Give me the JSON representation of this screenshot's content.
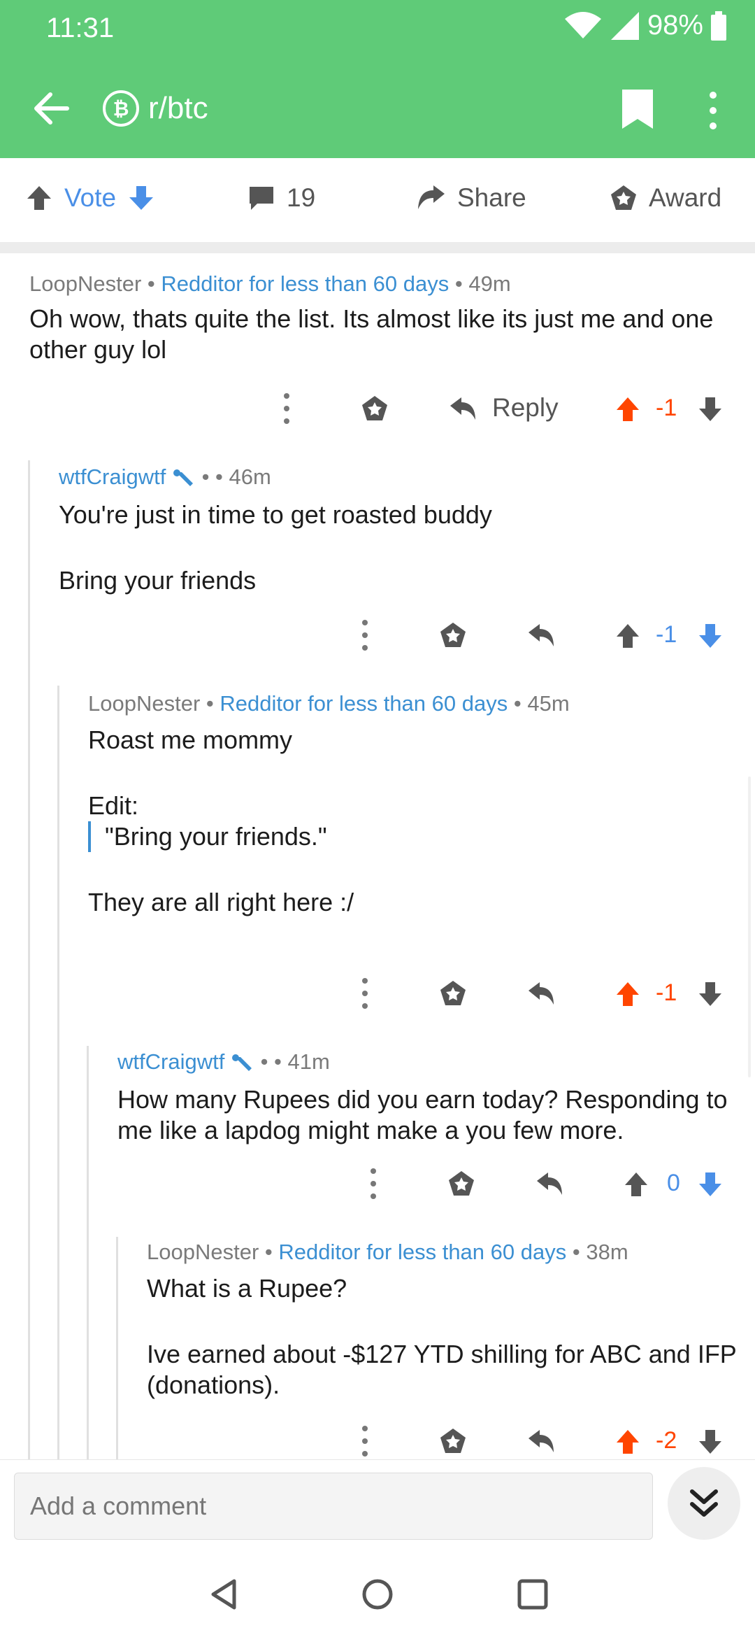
{
  "status": {
    "time": "11:31",
    "battery": "98%"
  },
  "header": {
    "subreddit": "r/btc"
  },
  "post_actions": {
    "vote_label": "Vote",
    "comment_count": "19",
    "share_label": "Share",
    "award_label": "Award"
  },
  "comments": [
    {
      "author": "LoopNester",
      "sep": "•",
      "flair": "Redditor for less than 60 days",
      "sep2": "•",
      "age": "49m",
      "body": [
        "Oh wow, thats quite the list. Its almost like its just me and one other guy lol"
      ],
      "reply_label": "Reply",
      "score": "-1",
      "vote_state": "up"
    },
    {
      "author": "wtfCraigwtf",
      "sep": "•",
      "sep2": "•",
      "age": "46m",
      "body": [
        "You're just in time to get roasted buddy",
        "Bring your friends"
      ],
      "score": "-1",
      "vote_state": "down"
    },
    {
      "author": "LoopNester",
      "sep": "•",
      "flair": "Redditor for less than 60 days",
      "sep2": "•",
      "age": "45m",
      "body": [
        "Roast me mommy",
        "Edit:"
      ],
      "quote": "\"Bring your friends.\"",
      "body_after": "They are all right here :/",
      "score": "-1",
      "vote_state": "up"
    },
    {
      "author": "wtfCraigwtf",
      "sep": "•",
      "sep2": "•",
      "age": "41m",
      "body": [
        "How many Rupees did you earn today? Responding to me like a lapdog might make a you few more."
      ],
      "score": "0",
      "vote_state": "down"
    },
    {
      "author": "LoopNester",
      "sep": "•",
      "flair": "Redditor for less than 60 days",
      "sep2": "•",
      "age": "38m",
      "body": [
        "What is a Rupee?",
        "Ive earned about -$127 YTD shilling for ABC and IFP (donations)."
      ],
      "score": "-2",
      "vote_state": "up"
    }
  ],
  "composer": {
    "placeholder": "Add a comment"
  },
  "colors": {
    "header_green": "#5fcb78",
    "upvote": "#ff4500",
    "downvote_blue": "#4a8fe7",
    "flair_blue": "#3b8fd2"
  },
  "icons": [
    "back-arrow-icon",
    "bitcoin-icon",
    "bookmark-icon",
    "more-vertical-icon",
    "upvote-arrow-icon",
    "downvote-arrow-icon",
    "comment-bubble-icon",
    "share-arrow-icon",
    "award-icon",
    "reply-icon",
    "wrench-icon",
    "double-chevron-down-icon"
  ]
}
